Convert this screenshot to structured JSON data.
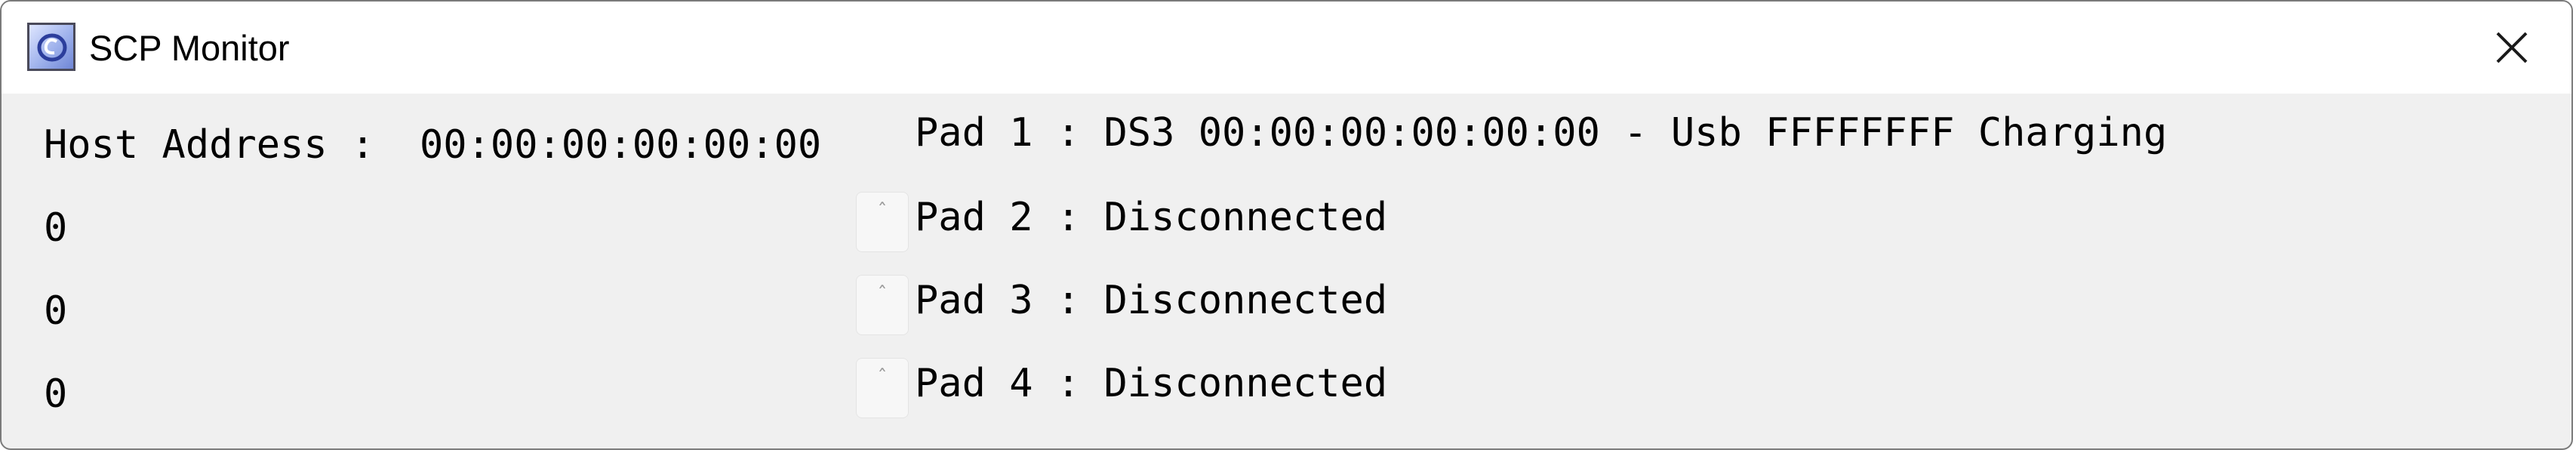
{
  "window": {
    "title": "SCP Monitor",
    "app_icon": "scp-app-icon",
    "close_icon": "close-icon"
  },
  "host": {
    "label": "Host Address :",
    "address": "00:00:00:00:00:00"
  },
  "counters": [
    "0",
    "0",
    "0"
  ],
  "spinners": [
    "ˆ",
    "ˆ",
    "ˆ"
  ],
  "pads": [
    {
      "label": "Pad 1 :",
      "status": "DS3 00:00:00:00:00:00 - Usb FFFFFFFF Charging"
    },
    {
      "label": "Pad 2 :",
      "status": "Disconnected"
    },
    {
      "label": "Pad 3 :",
      "status": "Disconnected"
    },
    {
      "label": "Pad 4 :",
      "status": "Disconnected"
    }
  ]
}
